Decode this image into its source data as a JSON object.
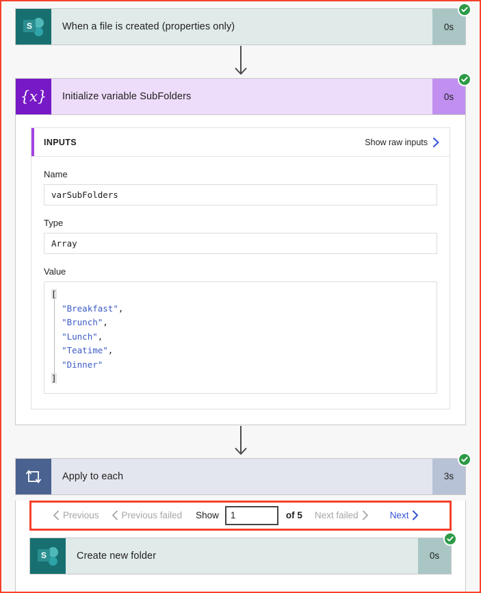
{
  "flow": {
    "steps": [
      {
        "id": "trigger",
        "icon": "sharepoint-icon",
        "icon_letter": "S",
        "title": "When a file is created (properties only)",
        "duration": "0s",
        "status": "succeeded",
        "status_icon": "check-circle-icon"
      },
      {
        "id": "init-variable",
        "icon": "variable-icon",
        "icon_glyph": "{x}",
        "title": "Initialize variable SubFolders",
        "duration": "0s",
        "status": "succeeded",
        "status_icon": "check-circle-icon"
      },
      {
        "id": "apply-to-each",
        "icon": "loop-icon",
        "title": "Apply to each",
        "duration": "3s",
        "status": "succeeded",
        "status_icon": "check-circle-icon"
      },
      {
        "id": "create-new-folder",
        "icon": "sharepoint-icon",
        "icon_letter": "S",
        "title": "Create new folder",
        "duration": "0s",
        "status": "succeeded",
        "status_icon": "check-circle-icon"
      }
    ]
  },
  "inputs_panel": {
    "header_label": "INPUTS",
    "show_raw_label": "Show raw inputs",
    "show_raw_icon": "chevron-right-icon",
    "accent_color": "#a442e0",
    "fields": [
      {
        "label": "Name",
        "value": "varSubFolders"
      },
      {
        "label": "Type",
        "value": "Array"
      }
    ],
    "value_field": {
      "label": "Value",
      "open_bracket": "[",
      "close_bracket": "]",
      "items": [
        {
          "text": "\"Breakfast\"",
          "comma": ","
        },
        {
          "text": "\"Brunch\"",
          "comma": ","
        },
        {
          "text": "\"Lunch\"",
          "comma": ","
        },
        {
          "text": "\"Teatime\"",
          "comma": ","
        },
        {
          "text": "\"Dinner\"",
          "comma": ""
        }
      ]
    }
  },
  "pager": {
    "previous_label": "Previous",
    "previous_icon": "chevron-left-icon",
    "previous_failed_label": "Previous failed",
    "previous_failed_icon": "chevron-left-icon",
    "show_label": "Show",
    "current_page": "1",
    "of_label": "of 5",
    "next_failed_label": "Next failed",
    "next_failed_icon": "chevron-right-icon",
    "next_label": "Next",
    "next_icon": "chevron-right-icon",
    "highlight_color": "#f6402c",
    "active_color": "#3754d8",
    "disabled_color": "#a6a6a6"
  },
  "colors": {
    "sharepoint_card": "#dfeae9",
    "sharepoint_icon": "#176f70",
    "variable_card": "#eedcfb",
    "variable_icon": "#7719c6",
    "loop_card": "#e3e6ef",
    "loop_icon": "#49628f",
    "success": "#2d9a46",
    "annotation": "#f6402c"
  }
}
